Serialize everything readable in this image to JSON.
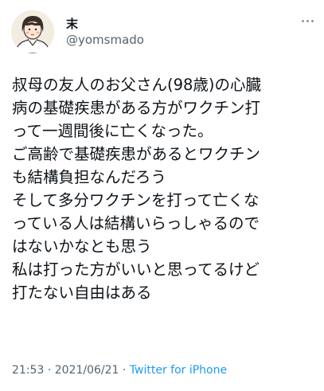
{
  "author": {
    "display_name": "末",
    "handle": "@yomsmado"
  },
  "menu": {
    "icon": "more-horizontal-icon"
  },
  "tweet": {
    "lines": [
      "叔母の友人のお父さん(98歳)の心臓",
      "病の基礎疾患がある方がワクチン打",
      "って一週間後に亡くなった。",
      "ご高齢で基礎疾患があるとワクチン",
      "も結構負担なんだろう",
      "そして多分ワクチンを打って亡くな",
      "っている人は結構いらっしゃるので",
      "はないかなとも思う",
      "私は打った方がいいと思ってるけど",
      "打たない自由はある"
    ],
    "time": "21:53",
    "separator_1": "·",
    "date": "2021/06/21",
    "separator_2": "·",
    "source": "Twitter for iPhone"
  },
  "colors": {
    "text": "#0f1419",
    "secondary": "#536471",
    "link": "#1d9bf0"
  }
}
